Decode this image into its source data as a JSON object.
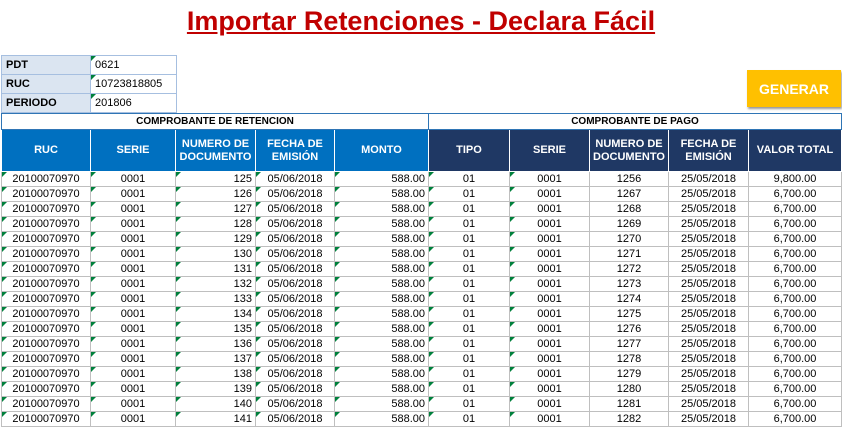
{
  "title": "Importar Retenciones - Declara Fácil",
  "info": {
    "pdt_label": "PDT",
    "pdt_value": "0621",
    "ruc_label": "RUC",
    "ruc_value": "10723818805",
    "periodo_label": "PERIODO",
    "periodo_value": "201806"
  },
  "generate_label": "GENERAR",
  "groups": {
    "retencion": "COMPROBANTE DE RETENCION",
    "pago": "COMPROBANTE DE PAGO"
  },
  "columns": [
    "RUC",
    "SERIE",
    "NUMERO DE DOCUMENTO",
    "FECHA DE EMISIÓN",
    "MONTO",
    "TIPO",
    "SERIE",
    "NUMERO DE DOCUMENTO",
    "FECHA DE EMISIÓN",
    "VALOR TOTAL"
  ],
  "rows": [
    [
      "20100070970",
      "0001",
      "125",
      "05/06/2018",
      "588.00",
      "01",
      "0001",
      "1256",
      "25/05/2018",
      "9,800.00"
    ],
    [
      "20100070970",
      "0001",
      "126",
      "05/06/2018",
      "588.00",
      "01",
      "0001",
      "1267",
      "25/05/2018",
      "6,700.00"
    ],
    [
      "20100070970",
      "0001",
      "127",
      "05/06/2018",
      "588.00",
      "01",
      "0001",
      "1268",
      "25/05/2018",
      "6,700.00"
    ],
    [
      "20100070970",
      "0001",
      "128",
      "05/06/2018",
      "588.00",
      "01",
      "0001",
      "1269",
      "25/05/2018",
      "6,700.00"
    ],
    [
      "20100070970",
      "0001",
      "129",
      "05/06/2018",
      "588.00",
      "01",
      "0001",
      "1270",
      "25/05/2018",
      "6,700.00"
    ],
    [
      "20100070970",
      "0001",
      "130",
      "05/06/2018",
      "588.00",
      "01",
      "0001",
      "1271",
      "25/05/2018",
      "6,700.00"
    ],
    [
      "20100070970",
      "0001",
      "131",
      "05/06/2018",
      "588.00",
      "01",
      "0001",
      "1272",
      "25/05/2018",
      "6,700.00"
    ],
    [
      "20100070970",
      "0001",
      "132",
      "05/06/2018",
      "588.00",
      "01",
      "0001",
      "1273",
      "25/05/2018",
      "6,700.00"
    ],
    [
      "20100070970",
      "0001",
      "133",
      "05/06/2018",
      "588.00",
      "01",
      "0001",
      "1274",
      "25/05/2018",
      "6,700.00"
    ],
    [
      "20100070970",
      "0001",
      "134",
      "05/06/2018",
      "588.00",
      "01",
      "0001",
      "1275",
      "25/05/2018",
      "6,700.00"
    ],
    [
      "20100070970",
      "0001",
      "135",
      "05/06/2018",
      "588.00",
      "01",
      "0001",
      "1276",
      "25/05/2018",
      "6,700.00"
    ],
    [
      "20100070970",
      "0001",
      "136",
      "05/06/2018",
      "588.00",
      "01",
      "0001",
      "1277",
      "25/05/2018",
      "6,700.00"
    ],
    [
      "20100070970",
      "0001",
      "137",
      "05/06/2018",
      "588.00",
      "01",
      "0001",
      "1278",
      "25/05/2018",
      "6,700.00"
    ],
    [
      "20100070970",
      "0001",
      "138",
      "05/06/2018",
      "588.00",
      "01",
      "0001",
      "1279",
      "25/05/2018",
      "6,700.00"
    ],
    [
      "20100070970",
      "0001",
      "139",
      "05/06/2018",
      "588.00",
      "01",
      "0001",
      "1280",
      "25/05/2018",
      "6,700.00"
    ],
    [
      "20100070970",
      "0001",
      "140",
      "05/06/2018",
      "588.00",
      "01",
      "0001",
      "1281",
      "25/05/2018",
      "6,700.00"
    ],
    [
      "20100070970",
      "0001",
      "141",
      "05/06/2018",
      "588.00",
      "01",
      "0001",
      "1282",
      "25/05/2018",
      "6,700.00"
    ]
  ]
}
